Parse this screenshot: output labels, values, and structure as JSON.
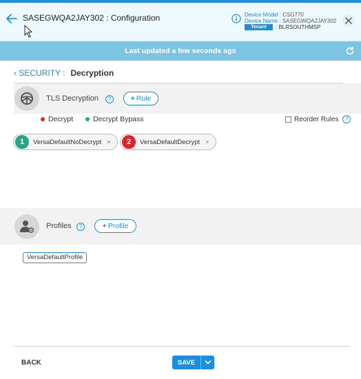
{
  "header": {
    "title": "SASEGWQA2JAY302 : Configuration",
    "device_model_label": "Device Model : ",
    "device_model": "CSG770",
    "device_name_label": "Device Name : ",
    "device_name": "SASEGWQA2JAY302",
    "tenant_badge": "Tenant",
    "tenant_name": ": BLRSOUTHMSP"
  },
  "status_bar": {
    "text": "Last updated a few seconds ago"
  },
  "breadcrumb": {
    "parent": "SECURITY :",
    "current": "Decryption"
  },
  "tls_section": {
    "title": "TLS Decryption",
    "help": "?",
    "add_rule_label": "Rule",
    "legend": [
      {
        "label": "Decrypt",
        "color": "#e8202a"
      },
      {
        "label": "Decrypt Bypass",
        "color": "#1fa988"
      }
    ],
    "reorder_label": "Reorder Rules",
    "rules": [
      {
        "number": "1",
        "name": "VersaDefaultNoDecrypt",
        "color": "#1fa988",
        "remove": "×"
      },
      {
        "number": "2",
        "name": "VersaDefaultDecrypt",
        "color": "#e8202a",
        "remove": "×"
      }
    ]
  },
  "profiles_section": {
    "title": "Profiles",
    "help": "?",
    "add_profile_label": "Profile",
    "profiles": [
      "VersaDefaultProfile"
    ]
  },
  "footer": {
    "back_label": "BACK",
    "save_label": "SAVE"
  },
  "colors": {
    "accent": "#1b8ee0",
    "status_bar": "#7dc4e2",
    "header_bg": "#eef9fd"
  }
}
